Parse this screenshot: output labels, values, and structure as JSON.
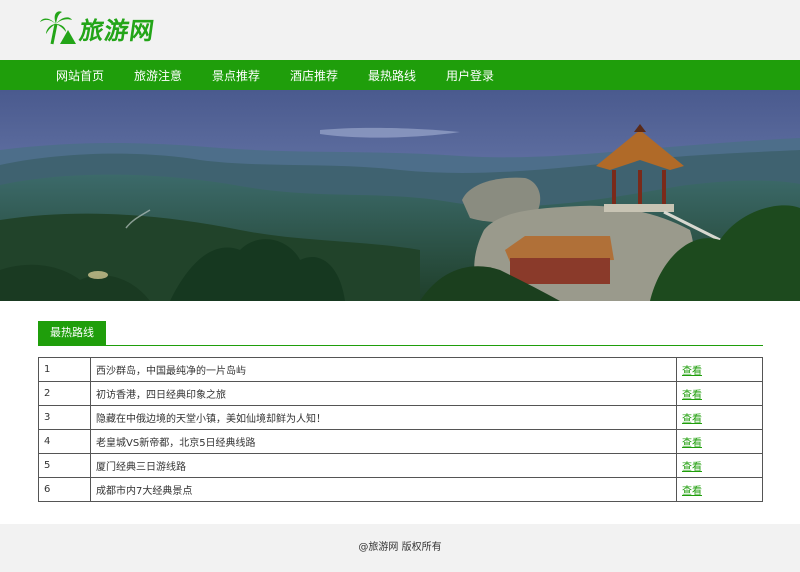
{
  "site": {
    "logo_text": "旅游网"
  },
  "nav": {
    "items": [
      "网站首页",
      "旅游注意",
      "景点推荐",
      "酒店推荐",
      "最热路线",
      "用户登录"
    ]
  },
  "section": {
    "title": "最热路线"
  },
  "routes": [
    {
      "num": "1",
      "title": "西沙群岛，中国最纯净的一片岛屿",
      "action": "查看"
    },
    {
      "num": "2",
      "title": "初访香港，四日经典印象之旅",
      "action": "查看"
    },
    {
      "num": "3",
      "title": "隐藏在中俄边境的天堂小镇，美如仙境却鲜为人知！",
      "action": "查看"
    },
    {
      "num": "4",
      "title": "老皇城VS新帝都，北京5日经典线路",
      "action": "查看"
    },
    {
      "num": "5",
      "title": "厦门经典三日游线路",
      "action": "查看"
    },
    {
      "num": "6",
      "title": "成都市内7大经典景点",
      "action": "查看"
    }
  ],
  "footer": {
    "copyright": "@旅游网 版权所有"
  },
  "colors": {
    "brand_green": "#1f9e0b",
    "logo_green": "#23a518"
  }
}
